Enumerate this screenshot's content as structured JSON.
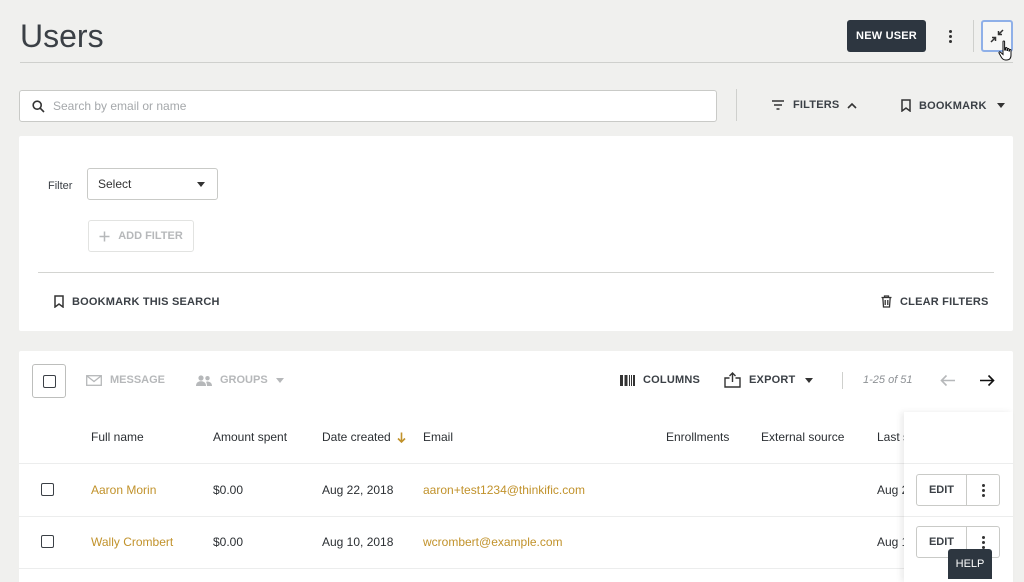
{
  "page": {
    "title": "Users"
  },
  "header": {
    "new_user_label": "NEW USER"
  },
  "search": {
    "placeholder": "Search by email or name"
  },
  "toolbar": {
    "filters_label": "FILTERS",
    "bookmark_label": "BOOKMARK"
  },
  "filter_panel": {
    "filter_label": "Filter",
    "select_value": "Select",
    "add_filter_label": "ADD FILTER",
    "bookmark_search_label": "BOOKMARK THIS SEARCH",
    "clear_filters_label": "CLEAR FILTERS"
  },
  "table_toolbar": {
    "message_label": "MESSAGE",
    "groups_label": "GROUPS",
    "columns_label": "COLUMNS",
    "export_label": "EXPORT",
    "pagination": "1-25 of 51"
  },
  "table": {
    "columns": [
      "Full name",
      "Amount spent",
      "Date created",
      "Email",
      "Enrollments",
      "External source",
      "Last s"
    ],
    "rows": [
      {
        "name": "Aaron Morin",
        "amount": "$0.00",
        "date": "Aug 22, 2018",
        "email": "aaron+test1234@thinkific.com",
        "last": "Aug 2"
      },
      {
        "name": "Wally Crombert",
        "amount": "$0.00",
        "date": "Aug 10, 2018",
        "email": "wcrombert@example.com",
        "last": "Aug 1"
      }
    ],
    "edit_label": "EDIT"
  },
  "help_label": "HELP",
  "colors": {
    "link": "#c1922b",
    "primary_button": "#2d3640",
    "focus_ring": "#8fb0e8"
  }
}
